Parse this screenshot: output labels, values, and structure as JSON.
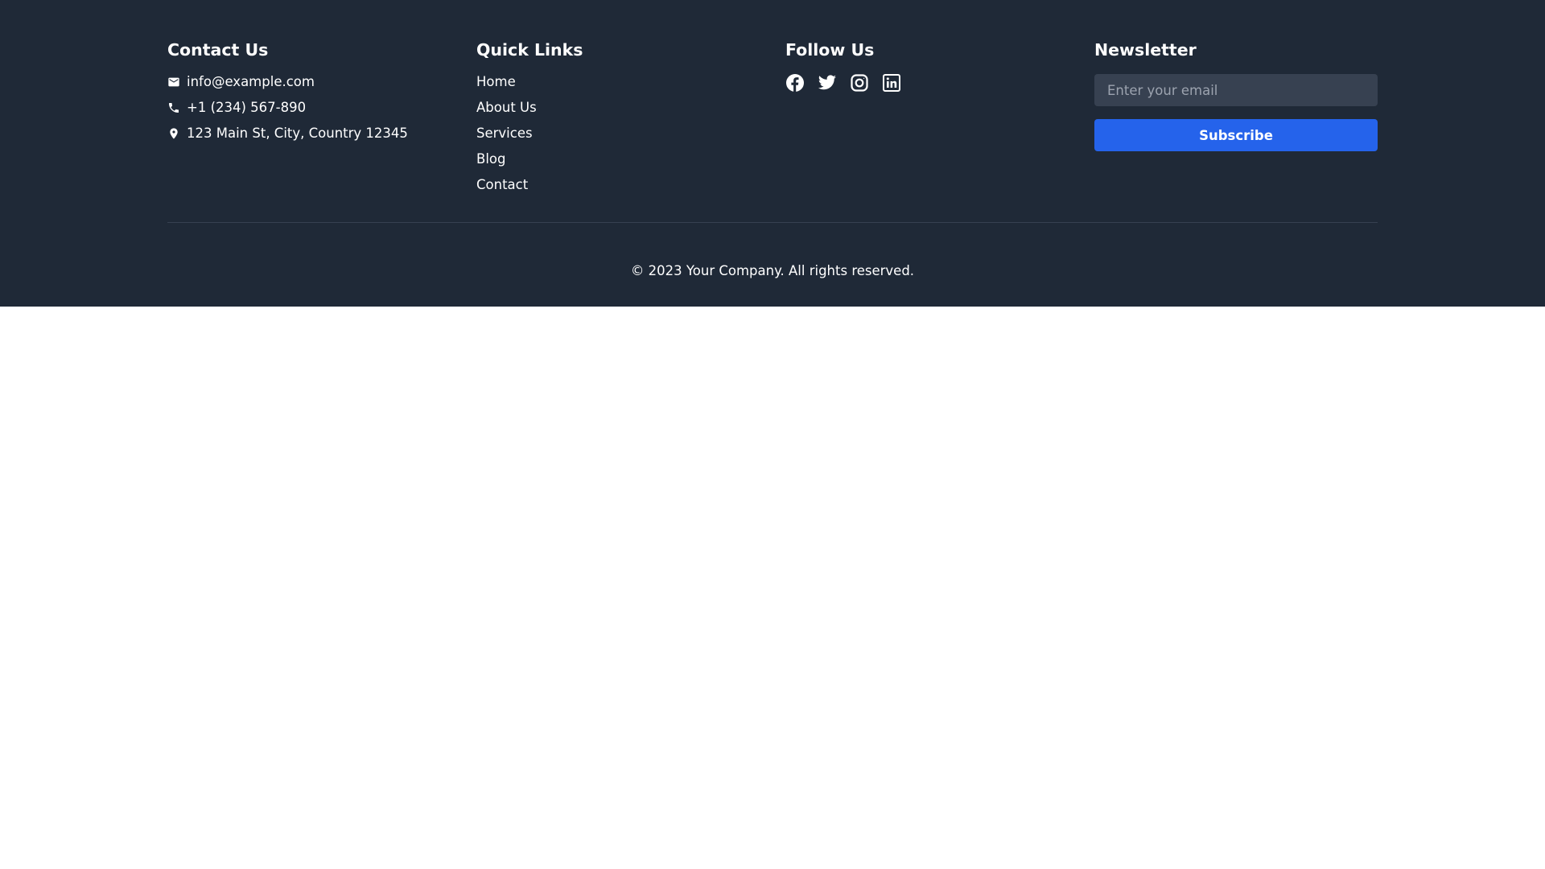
{
  "colors": {
    "footer_bg": "#1f2937",
    "input_bg": "#374151",
    "accent": "#2563eb",
    "text": "#ffffff",
    "placeholder": "#9ca3af"
  },
  "contact": {
    "heading": "Contact Us",
    "items": [
      {
        "icon": "mail-icon",
        "text": "info@example.com"
      },
      {
        "icon": "phone-icon",
        "text": "+1 (234) 567-890"
      },
      {
        "icon": "location-pin-icon",
        "text": "123 Main St, City, Country 12345"
      }
    ]
  },
  "quick_links": {
    "heading": "Quick Links",
    "items": [
      "Home",
      "About Us",
      "Services",
      "Blog",
      "Contact"
    ]
  },
  "follow": {
    "heading": "Follow Us",
    "icons": [
      "facebook-icon",
      "twitter-icon",
      "instagram-icon",
      "linkedin-icon"
    ]
  },
  "newsletter": {
    "heading": "Newsletter",
    "email_placeholder": "Enter your email",
    "email_value": "",
    "subscribe_label": "Subscribe"
  },
  "copyright": "© 2023 Your Company. All rights reserved."
}
